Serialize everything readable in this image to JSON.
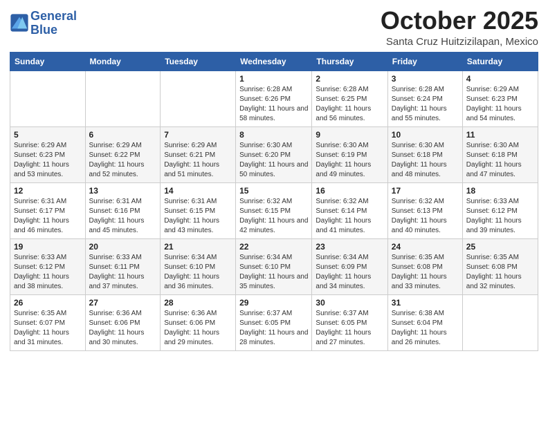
{
  "logo": {
    "line1": "General",
    "line2": "Blue"
  },
  "title": "October 2025",
  "subtitle": "Santa Cruz Huitzizilapan, Mexico",
  "weekdays": [
    "Sunday",
    "Monday",
    "Tuesday",
    "Wednesday",
    "Thursday",
    "Friday",
    "Saturday"
  ],
  "weeks": [
    [
      {
        "day": "",
        "info": ""
      },
      {
        "day": "",
        "info": ""
      },
      {
        "day": "",
        "info": ""
      },
      {
        "day": "1",
        "info": "Sunrise: 6:28 AM\nSunset: 6:26 PM\nDaylight: 11 hours and 58 minutes."
      },
      {
        "day": "2",
        "info": "Sunrise: 6:28 AM\nSunset: 6:25 PM\nDaylight: 11 hours and 56 minutes."
      },
      {
        "day": "3",
        "info": "Sunrise: 6:28 AM\nSunset: 6:24 PM\nDaylight: 11 hours and 55 minutes."
      },
      {
        "day": "4",
        "info": "Sunrise: 6:29 AM\nSunset: 6:23 PM\nDaylight: 11 hours and 54 minutes."
      }
    ],
    [
      {
        "day": "5",
        "info": "Sunrise: 6:29 AM\nSunset: 6:23 PM\nDaylight: 11 hours and 53 minutes."
      },
      {
        "day": "6",
        "info": "Sunrise: 6:29 AM\nSunset: 6:22 PM\nDaylight: 11 hours and 52 minutes."
      },
      {
        "day": "7",
        "info": "Sunrise: 6:29 AM\nSunset: 6:21 PM\nDaylight: 11 hours and 51 minutes."
      },
      {
        "day": "8",
        "info": "Sunrise: 6:30 AM\nSunset: 6:20 PM\nDaylight: 11 hours and 50 minutes."
      },
      {
        "day": "9",
        "info": "Sunrise: 6:30 AM\nSunset: 6:19 PM\nDaylight: 11 hours and 49 minutes."
      },
      {
        "day": "10",
        "info": "Sunrise: 6:30 AM\nSunset: 6:18 PM\nDaylight: 11 hours and 48 minutes."
      },
      {
        "day": "11",
        "info": "Sunrise: 6:30 AM\nSunset: 6:18 PM\nDaylight: 11 hours and 47 minutes."
      }
    ],
    [
      {
        "day": "12",
        "info": "Sunrise: 6:31 AM\nSunset: 6:17 PM\nDaylight: 11 hours and 46 minutes."
      },
      {
        "day": "13",
        "info": "Sunrise: 6:31 AM\nSunset: 6:16 PM\nDaylight: 11 hours and 45 minutes."
      },
      {
        "day": "14",
        "info": "Sunrise: 6:31 AM\nSunset: 6:15 PM\nDaylight: 11 hours and 43 minutes."
      },
      {
        "day": "15",
        "info": "Sunrise: 6:32 AM\nSunset: 6:15 PM\nDaylight: 11 hours and 42 minutes."
      },
      {
        "day": "16",
        "info": "Sunrise: 6:32 AM\nSunset: 6:14 PM\nDaylight: 11 hours and 41 minutes."
      },
      {
        "day": "17",
        "info": "Sunrise: 6:32 AM\nSunset: 6:13 PM\nDaylight: 11 hours and 40 minutes."
      },
      {
        "day": "18",
        "info": "Sunrise: 6:33 AM\nSunset: 6:12 PM\nDaylight: 11 hours and 39 minutes."
      }
    ],
    [
      {
        "day": "19",
        "info": "Sunrise: 6:33 AM\nSunset: 6:12 PM\nDaylight: 11 hours and 38 minutes."
      },
      {
        "day": "20",
        "info": "Sunrise: 6:33 AM\nSunset: 6:11 PM\nDaylight: 11 hours and 37 minutes."
      },
      {
        "day": "21",
        "info": "Sunrise: 6:34 AM\nSunset: 6:10 PM\nDaylight: 11 hours and 36 minutes."
      },
      {
        "day": "22",
        "info": "Sunrise: 6:34 AM\nSunset: 6:10 PM\nDaylight: 11 hours and 35 minutes."
      },
      {
        "day": "23",
        "info": "Sunrise: 6:34 AM\nSunset: 6:09 PM\nDaylight: 11 hours and 34 minutes."
      },
      {
        "day": "24",
        "info": "Sunrise: 6:35 AM\nSunset: 6:08 PM\nDaylight: 11 hours and 33 minutes."
      },
      {
        "day": "25",
        "info": "Sunrise: 6:35 AM\nSunset: 6:08 PM\nDaylight: 11 hours and 32 minutes."
      }
    ],
    [
      {
        "day": "26",
        "info": "Sunrise: 6:35 AM\nSunset: 6:07 PM\nDaylight: 11 hours and 31 minutes."
      },
      {
        "day": "27",
        "info": "Sunrise: 6:36 AM\nSunset: 6:06 PM\nDaylight: 11 hours and 30 minutes."
      },
      {
        "day": "28",
        "info": "Sunrise: 6:36 AM\nSunset: 6:06 PM\nDaylight: 11 hours and 29 minutes."
      },
      {
        "day": "29",
        "info": "Sunrise: 6:37 AM\nSunset: 6:05 PM\nDaylight: 11 hours and 28 minutes."
      },
      {
        "day": "30",
        "info": "Sunrise: 6:37 AM\nSunset: 6:05 PM\nDaylight: 11 hours and 27 minutes."
      },
      {
        "day": "31",
        "info": "Sunrise: 6:38 AM\nSunset: 6:04 PM\nDaylight: 11 hours and 26 minutes."
      },
      {
        "day": "",
        "info": ""
      }
    ]
  ]
}
